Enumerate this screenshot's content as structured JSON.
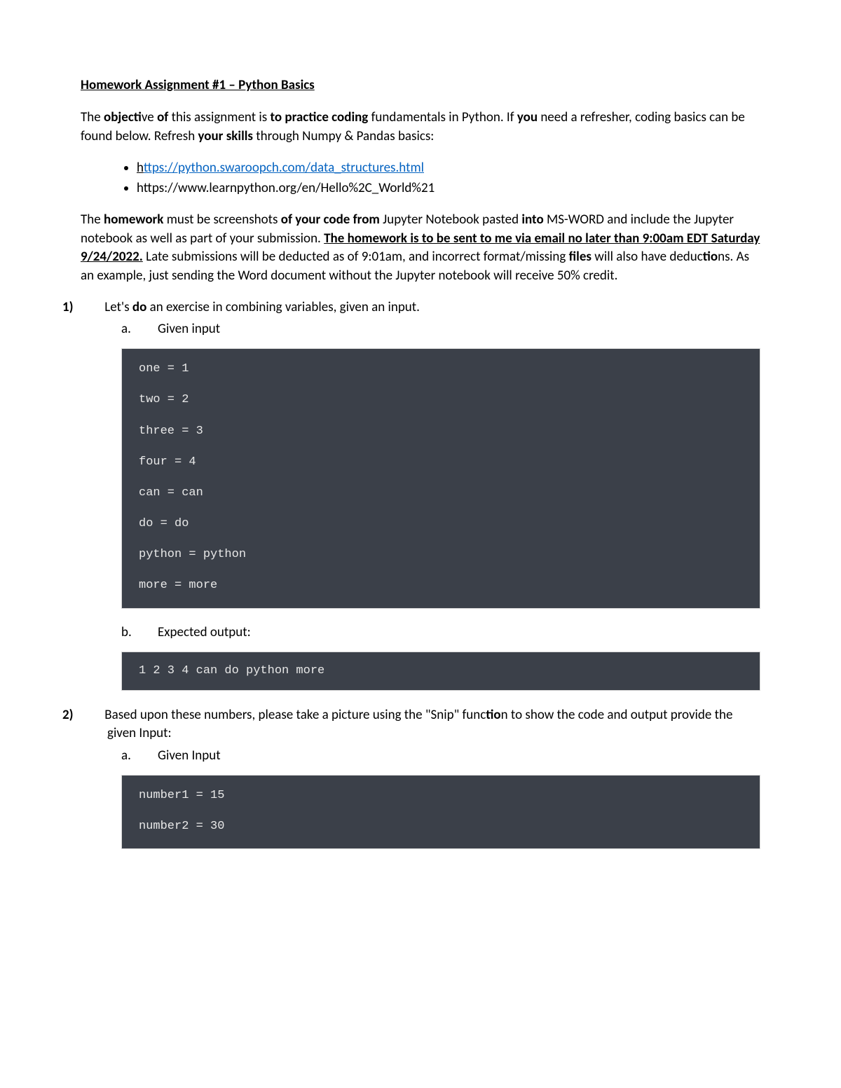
{
  "title": "Homework Assignment #1 – Python Basics",
  "intro_part1": "The ",
  "intro_bold1": "objecti",
  "intro_part2": "ve ",
  "intro_bold2": "of ",
  "intro_part3": "this assignment is ",
  "intro_bold3": "to practice coding ",
  "intro_part4": "fundamentals in Python.  If ",
  "intro_bold4": "you ",
  "intro_part5": "need a refresher, coding basics can be found below.   Refresh ",
  "intro_bold5": "your skills ",
  "intro_part6": "through Numpy & Pandas basics:",
  "links": [
    {
      "first": "h",
      "rest": "ttps://python.swaroopch.com/data_structures.html",
      "hyperlink": true
    },
    {
      "text": "https://www.learnpython.org/en/Hello%2C_World%21",
      "hyperlink": false
    }
  ],
  "para2_a": "The ",
  "para2_b": "homework ",
  "para2_c": "must be screenshots ",
  "para2_d": "of your code from ",
  "para2_e": "Jupyter Notebook pasted ",
  "para2_f": "into ",
  "para2_g": "MS-WORD and include the Jupyter notebook as well as part of your submission.  ",
  "para2_bold_u": "The homework is to be sent to me via  email no later than 9:00am EDT Saturday 9/24/2022.",
  "para2_h": "  Late submissions will be deducted as of 9:01am, and incorrect format/missing ",
  "para2_i": "files ",
  "para2_j": "will also have deduc",
  "para2_k": "tio",
  "para2_l": "ns.  As an example, just sending the Word document without the Jupyter notebook will receive 50% credit.",
  "q1_num": "1)",
  "q1_a": "Let's ",
  "q1_b": "do ",
  "q1_c": "an exercise in combining variables, given an input.",
  "q1_sub_a_label": "a.",
  "q1_sub_a_text": "Given input",
  "code1": "one = 1\n\ntwo = 2\n\nthree = 3\n\nfour = 4\n\ncan = can\n\ndo = do\n\npython = python\n\nmore = more",
  "q1_sub_b_label": "b.",
  "q1_sub_b_text": "Expected output:",
  "code2": "1 2 3 4 can do python more",
  "q2_num": "2)",
  "q2_text_a": "Based upon these numbers, please take a picture using the \"Snip\" func",
  "q2_text_b": "tio",
  "q2_text_c": "n to show the code and output provide the given Input:",
  "q2_sub_a_label": "a.",
  "q2_sub_a_text": "Given Input",
  "code3": "number1 = 15\n\nnumber2 = 30"
}
